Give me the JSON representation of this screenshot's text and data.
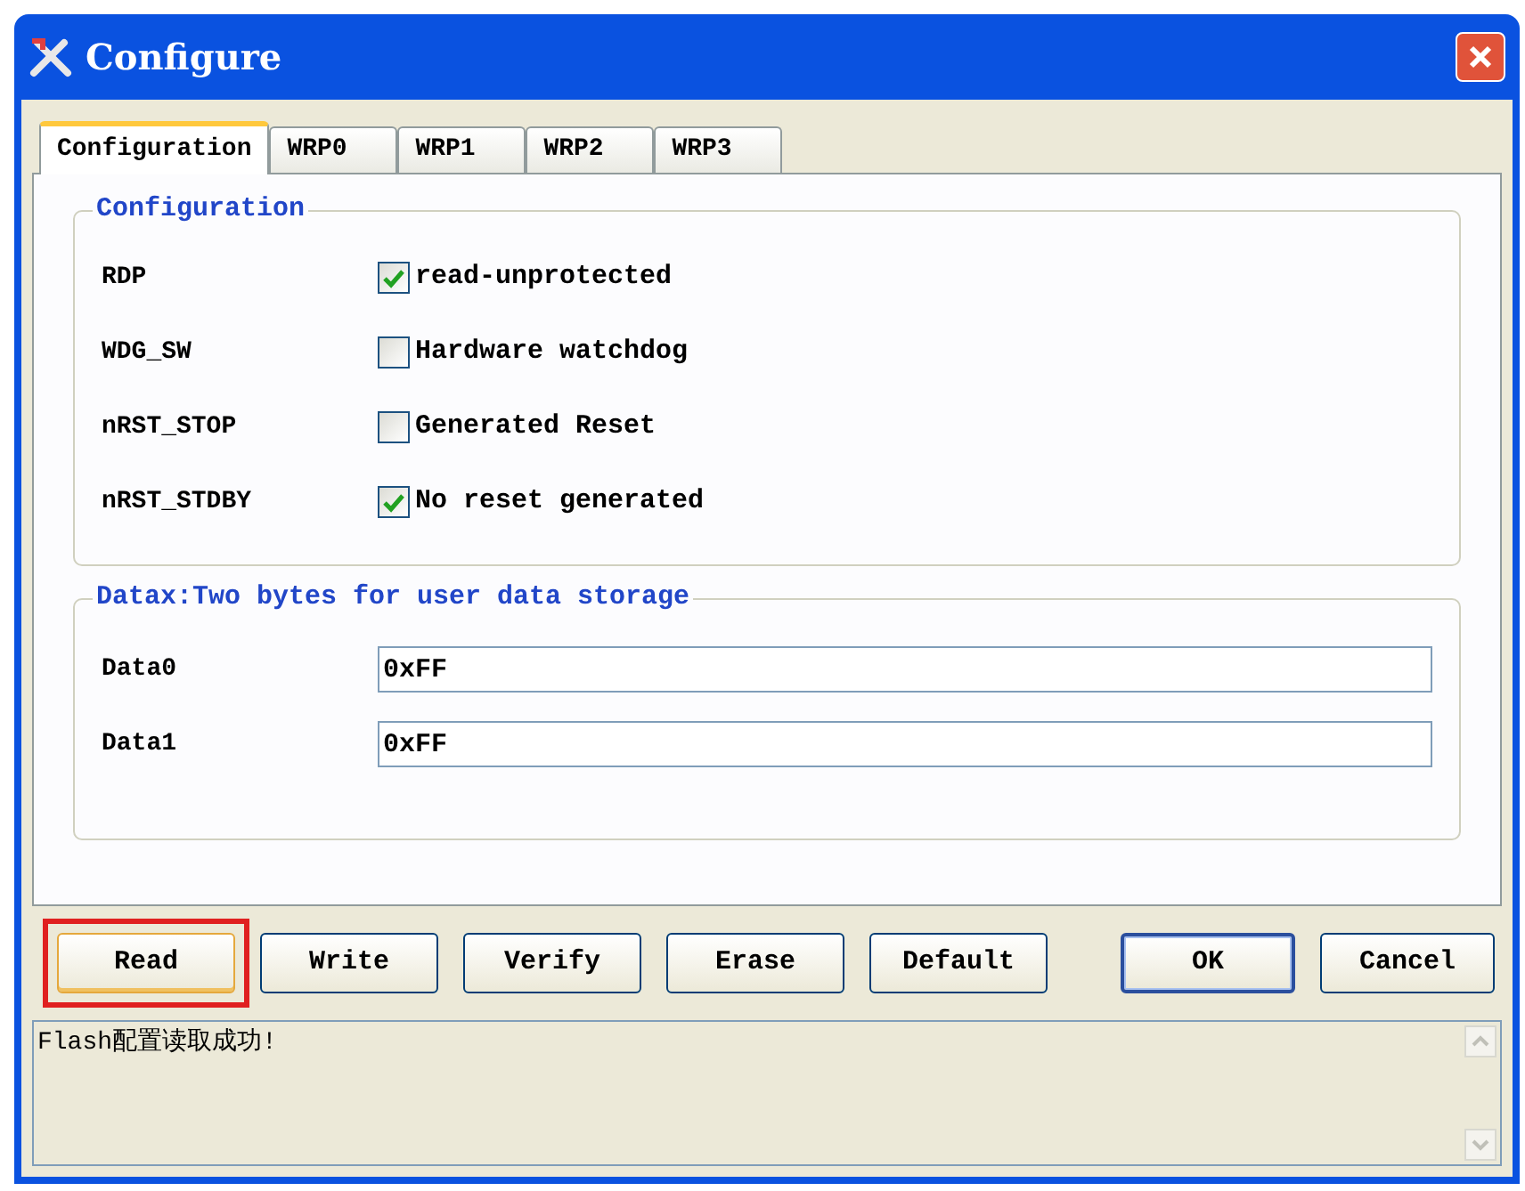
{
  "window": {
    "title": "Configure"
  },
  "tabs": [
    {
      "label": "Configuration",
      "selected": true
    },
    {
      "label": "WRP0",
      "selected": false
    },
    {
      "label": "WRP1",
      "selected": false
    },
    {
      "label": "WRP2",
      "selected": false
    },
    {
      "label": "WRP3",
      "selected": false
    }
  ],
  "configuration_group": {
    "title": "Configuration",
    "rows": [
      {
        "label": "RDP",
        "option": "read-unprotected",
        "checked": true
      },
      {
        "label": "WDG_SW",
        "option": "Hardware watchdog",
        "checked": false
      },
      {
        "label": "nRST_STOP",
        "option": "Generated Reset",
        "checked": false
      },
      {
        "label": "nRST_STDBY",
        "option": "No reset generated",
        "checked": true
      }
    ]
  },
  "data_group": {
    "title": "Datax:Two bytes for user data storage",
    "fields": [
      {
        "label": "Data0",
        "value": "0xFF"
      },
      {
        "label": "Data1",
        "value": "0xFF"
      }
    ]
  },
  "buttons": [
    {
      "label": "Read",
      "highlighted": true,
      "default": false
    },
    {
      "label": "Write",
      "highlighted": false,
      "default": false
    },
    {
      "label": "Verify",
      "highlighted": false,
      "default": false
    },
    {
      "label": "Erase",
      "highlighted": false,
      "default": false
    },
    {
      "label": "Default",
      "highlighted": false,
      "default": false
    }
  ],
  "dialog_buttons": [
    {
      "label": "OK",
      "highlighted": false,
      "default": true
    },
    {
      "label": "Cancel",
      "highlighted": false,
      "default": false
    }
  ],
  "status_log": {
    "text": "Flash配置读取成功!"
  }
}
